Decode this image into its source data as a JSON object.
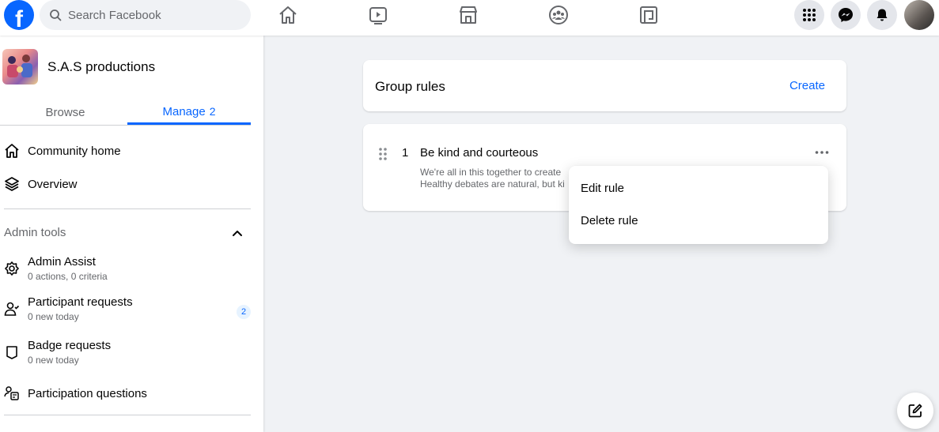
{
  "colors": {
    "brand_blue": "#0866ff",
    "secondary_text": "#65676b",
    "page_bg": "#f0f2f5"
  },
  "topbar": {
    "logo_glyph": "f",
    "search": {
      "placeholder": "Search Facebook",
      "value": ""
    },
    "nav_icons": [
      "home-icon",
      "watch-icon",
      "marketplace-icon",
      "groups-icon",
      "gaming-icon"
    ],
    "right_icons": [
      "menu-grid-icon",
      "messenger-icon",
      "notifications-icon",
      "profile-avatar"
    ]
  },
  "sidebar": {
    "group_name": "S.A.S productions",
    "tabs": {
      "browse": "Browse",
      "manage": "Manage",
      "manage_count": "2"
    },
    "items": [
      {
        "label": "Community home",
        "icon": "home-outline-icon"
      },
      {
        "label": "Overview",
        "icon": "layers-icon"
      }
    ],
    "admin_tools": {
      "title": "Admin tools",
      "items": [
        {
          "label": "Admin Assist",
          "sub": "0 actions, 0 criteria",
          "icon": "admin-assist-icon"
        },
        {
          "label": "Participant requests",
          "sub": "0 new today",
          "icon": "participant-icon",
          "badge": "2"
        },
        {
          "label": "Badge requests",
          "sub": "0 new today",
          "icon": "badge-icon"
        },
        {
          "label": "Participation questions",
          "icon": "questions-icon"
        }
      ]
    }
  },
  "main": {
    "rules_header": {
      "title": "Group rules",
      "create": "Create"
    },
    "rule": {
      "number": "1",
      "title": "Be kind and courteous",
      "description_line1": "We're all in this together to create",
      "description_line2": "Healthy debates are natural, but ki"
    },
    "menu": {
      "edit": "Edit rule",
      "delete": "Delete rule"
    }
  }
}
